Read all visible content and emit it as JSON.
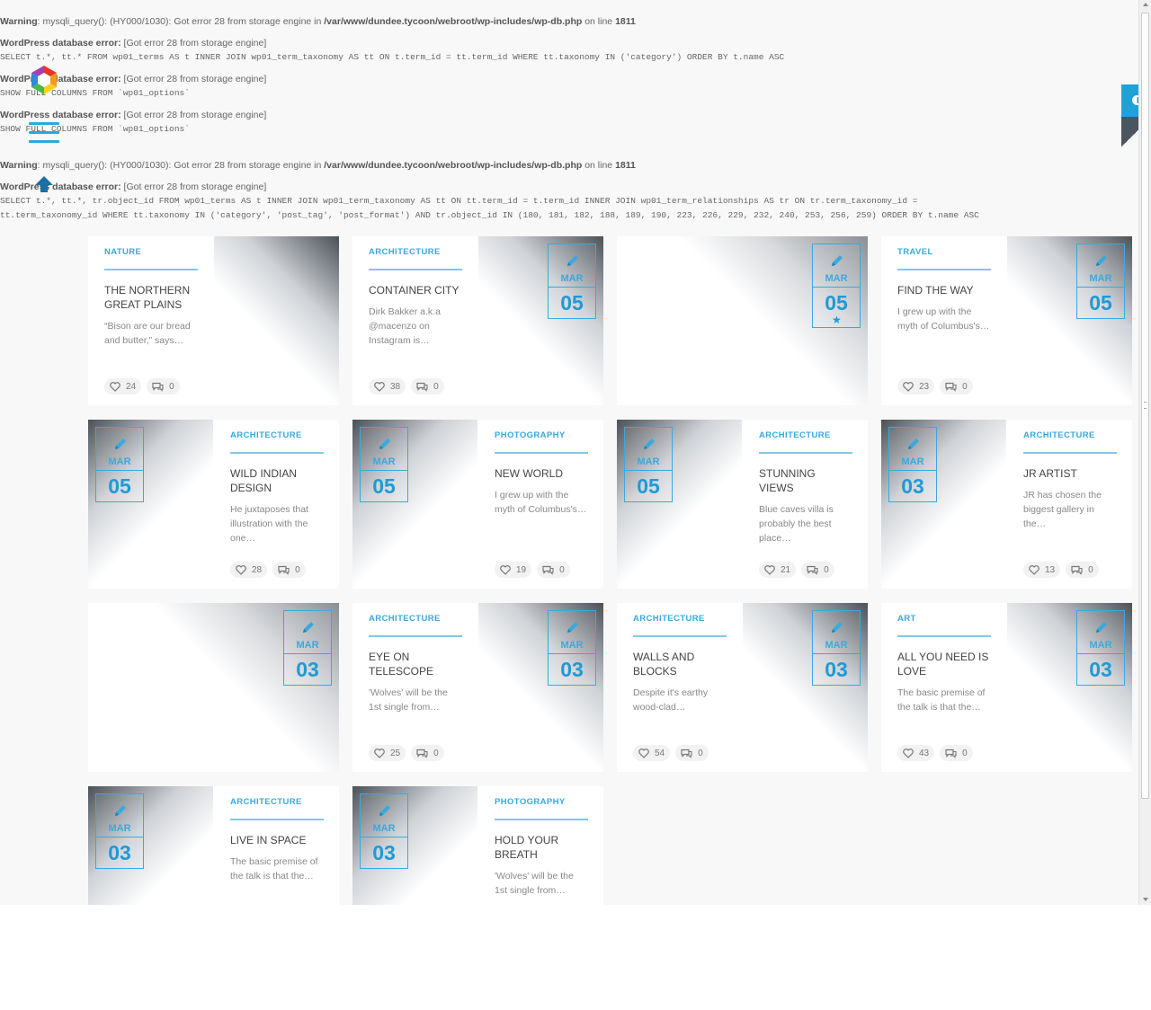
{
  "errors": {
    "warning1_label": "Warning",
    "warning1_pre": ": mysqli_query(): (HY000/1030): Got error 28 from storage engine in ",
    "warning1_path": "/var/www/dundee.tycoon/webroot/wp-includes/wp-db.php",
    "warning1_mid": " on line ",
    "warning1_line": "1811",
    "db_error_label": "WordPress database error:",
    "db_error_msg": " [Got error 28 from storage engine]",
    "sql1": "SELECT t.*, tt.* FROM wp01_terms AS t INNER JOIN wp01_term_taxonomy AS tt ON t.term_id = tt.term_id WHERE tt.taxonomy IN ('category') ORDER BY t.name ASC",
    "sql2": "SHOW FULL COLUMNS FROM `wp01_options`",
    "sql3": "SHOW FULL COLUMNS FROM `wp01_options`",
    "sql4a": "SELECT t.*, tt.*, tr.object_id FROM wp01_terms AS t INNER JOIN wp01_term_taxonomy AS tt ON tt.term_id = t.term_id INNER JOIN wp01_term_relationships AS tr ON tr.term_taxonomy_id =",
    "sql4b": "tt.term_taxonomy_id WHERE tt.taxonomy IN ('category', 'post_tag', 'post_format') AND tr.object_id IN (180, 181, 182, 188, 189, 190, 223, 226, 229, 232, 240, 253, 256, 259) ORDER BY t.name ASC"
  },
  "theme": {
    "accent": "#3aa9dd",
    "toggle_bg": "#1fa2d8"
  },
  "icons": {
    "logo": "hexagon-logo-icon",
    "menu": "hamburger-menu-icon",
    "up": "scroll-up-arrow-icon",
    "like": "heart-icon",
    "comment": "comment-bubble-icon",
    "edit": "pencil-icon",
    "contrast": "contrast-toggle-icon"
  },
  "posts": [
    {
      "category": "NATURE",
      "title": "THE NORTHERN GREAT PLAINS",
      "excerpt": "“Bison are our bread and butter,” says…",
      "likes": "24",
      "comments": "0"
    },
    {
      "category": "ARCHITECTURE",
      "title": "CONTAINER CITY",
      "excerpt": "Dirk Bakker a.k.a @macenzo on Instagram is…",
      "likes": "38",
      "comments": "0",
      "month": "MAR",
      "day": "05"
    },
    {
      "month": "MAR",
      "day": "05",
      "star": "★"
    },
    {
      "category": "TRAVEL",
      "title": "FIND THE WAY",
      "excerpt": "I grew up with the myth of Columbus's…",
      "likes": "23",
      "comments": "0",
      "month": "MAR",
      "day": "05"
    },
    {
      "category": "ARCHITECTURE",
      "title": "WILD INDIAN DESIGN",
      "excerpt": "He juxtaposes that illustration with the one…",
      "likes": "28",
      "comments": "0",
      "month": "MAR",
      "day": "05"
    },
    {
      "category": "PHOTOGRAPHY",
      "title": "NEW WORLD",
      "excerpt": "I grew up with the myth of Columbus's…",
      "likes": "19",
      "comments": "0",
      "month": "MAR",
      "day": "05"
    },
    {
      "category": "ARCHITECTURE",
      "title": "STUNNING VIEWS",
      "excerpt": "Blue caves villa is probably the best place…",
      "likes": "21",
      "comments": "0",
      "month": "MAR",
      "day": "05"
    },
    {
      "category": "ARCHITECTURE",
      "title": "JR ARTIST",
      "excerpt": "JR has chosen the biggest gallery in the…",
      "likes": "13",
      "comments": "0",
      "month": "MAR",
      "day": "03"
    },
    {
      "month": "MAR",
      "day": "03"
    },
    {
      "category": "ARCHITECTURE",
      "title": "EYE ON TELESCOPE",
      "excerpt": "'Wolves' will be the 1st single from…",
      "likes": "25",
      "comments": "0",
      "month": "MAR",
      "day": "03"
    },
    {
      "category": "ARCHITECTURE",
      "title": "WALLS AND BLOCKS",
      "excerpt": "Despite it's earthy wood-clad…",
      "likes": "54",
      "comments": "0",
      "month": "MAR",
      "day": "03"
    },
    {
      "category": "ART",
      "title": "ALL YOU NEED IS LOVE",
      "excerpt": "The basic premise of the talk is that the…",
      "likes": "43",
      "comments": "0",
      "month": "MAR",
      "day": "03"
    },
    {
      "category": "ARCHITECTURE",
      "title": "LIVE IN SPACE",
      "excerpt": "The basic premise of the talk is that the…",
      "month": "MAR",
      "day": "03"
    },
    {
      "category": "PHOTOGRAPHY",
      "title": "HOLD YOUR BREATH",
      "excerpt": "'Wolves' will be the 1st single from…",
      "month": "MAR",
      "day": "03"
    }
  ]
}
